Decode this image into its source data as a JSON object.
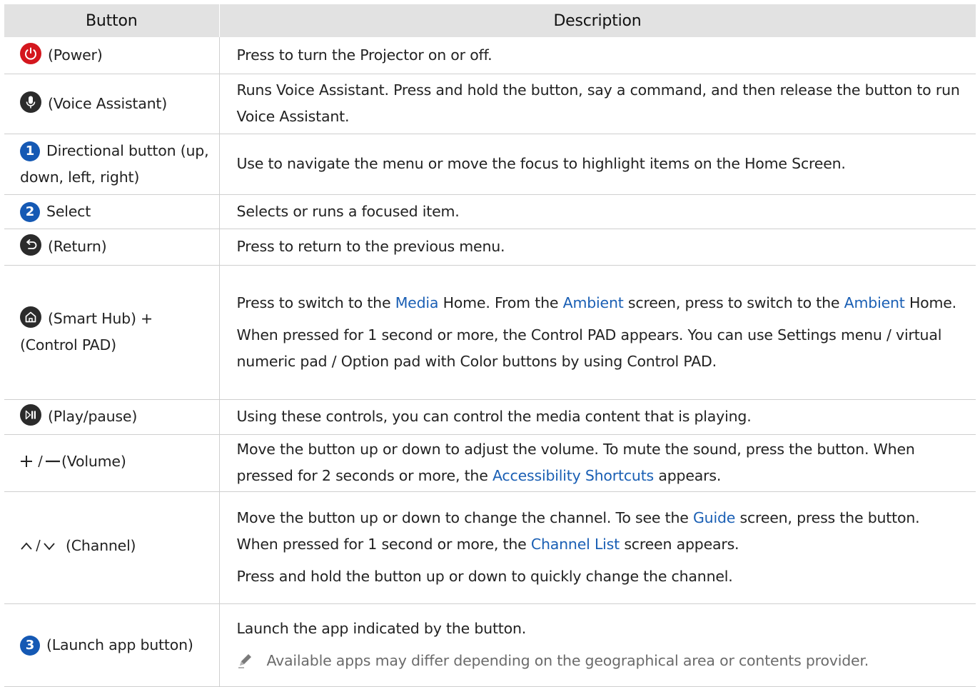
{
  "headers": {
    "button": "Button",
    "description": "Description"
  },
  "rows": {
    "power": {
      "icon": "power-icon",
      "label": "(Power)",
      "desc": "Press to turn the Projector on or off."
    },
    "voice": {
      "icon": "microphone-icon",
      "label": "(Voice Assistant)",
      "desc": "Runs Voice Assistant. Press and hold the button, say a command, and then release the button to run Voice Assistant."
    },
    "directional": {
      "num": "1",
      "label": "Directional button (up, down, left, right)",
      "desc": "Use to navigate the menu or move the focus to highlight items on the Home Screen."
    },
    "select": {
      "num": "2",
      "label": "Select",
      "desc": "Selects or runs a focused item."
    },
    "return": {
      "icon": "return-icon",
      "label": "(Return)",
      "desc": "Press to return to the previous menu."
    },
    "smarthub": {
      "icon": "home-icon",
      "label": "(Smart Hub) + (Control PAD)",
      "d1a": "Press to switch to the ",
      "d1_link1": "Media",
      "d1b": " Home. From the ",
      "d1_link2": "Ambient",
      "d1c": " screen, press to switch to the ",
      "d1_link3": "Ambient",
      "d1d": " Home.",
      "d2": "When pressed for 1 second or more, the Control PAD appears. You can use Settings menu / virtual numeric pad / Option pad with Color buttons by using Control PAD."
    },
    "playpause": {
      "icon": "play-pause-icon",
      "label": "(Play/pause)",
      "desc": "Using these controls, you can control the media content that is playing."
    },
    "volume": {
      "icon": "plus-minus-icon",
      "label": "(Volume)",
      "d1a": "Move the button up or down to adjust the volume. To mute the sound, press the button. When pressed for 2 seconds or more, the ",
      "d1_link": "Accessibility Shortcuts",
      "d1b": " appears."
    },
    "channel": {
      "icon": "chevron-up-down-icon",
      "label": "(Channel)",
      "d1a": "Move the button up or down to change the channel. To see the ",
      "d1_link1": "Guide",
      "d1b": " screen, press the button. When pressed for 1 second or more, the ",
      "d1_link2": "Channel List",
      "d1c": " screen appears.",
      "d2": "Press and hold the button up or down to quickly change the channel."
    },
    "launch": {
      "num": "3",
      "label": "(Launch app button)",
      "desc": "Launch the app indicated by the button.",
      "note": "Available apps may differ depending on the geographical area or contents provider."
    }
  },
  "colors": {
    "header_bg": "#e2e2e2",
    "link": "#1a5fb4",
    "number_badge": "#1559b4",
    "power": "#d4171e",
    "icon_dark": "#2b2b2b",
    "note_text": "#6b6b6b"
  }
}
